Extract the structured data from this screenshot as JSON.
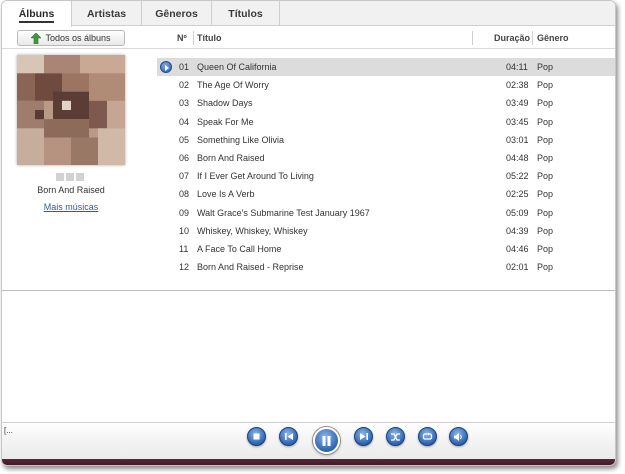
{
  "tabs": [
    {
      "label": "Álbuns",
      "active": true
    },
    {
      "label": "Artistas",
      "active": false
    },
    {
      "label": "Gêneros",
      "active": false
    },
    {
      "label": "Títulos",
      "active": false
    }
  ],
  "toolbar": {
    "all_albums_label": "Todos os álbuns",
    "all_albums_icon": "up-arrow-icon"
  },
  "columns": {
    "number": "Nº",
    "title": "Título",
    "duration": "Duração",
    "genre": "Gênero"
  },
  "album": {
    "name": "Born And Raised",
    "more_link": "Mais músicas"
  },
  "tracks": [
    {
      "num": "01",
      "title": "Queen Of California",
      "duration": "04:11",
      "genre": "Pop",
      "playing": true
    },
    {
      "num": "02",
      "title": "The Age Of Worry",
      "duration": "02:38",
      "genre": "Pop"
    },
    {
      "num": "03",
      "title": "Shadow Days",
      "duration": "03:49",
      "genre": "Pop"
    },
    {
      "num": "04",
      "title": "Speak For Me",
      "duration": "03:45",
      "genre": "Pop"
    },
    {
      "num": "05",
      "title": "Something Like Olivia",
      "duration": "03:01",
      "genre": "Pop"
    },
    {
      "num": "06",
      "title": "Born And Raised",
      "duration": "04:48",
      "genre": "Pop"
    },
    {
      "num": "07",
      "title": "If I Ever Get Around To Living",
      "duration": "05:22",
      "genre": "Pop"
    },
    {
      "num": "08",
      "title": "Love Is A Verb",
      "duration": "02:25",
      "genre": "Pop"
    },
    {
      "num": "09",
      "title": "Walt Grace's Submarine Test January 1967",
      "duration": "05:09",
      "genre": "Pop"
    },
    {
      "num": "10",
      "title": "Whiskey, Whiskey, Whiskey",
      "duration": "04:39",
      "genre": "Pop"
    },
    {
      "num": "11",
      "title": "A Face To Call Home",
      "duration": "04:46",
      "genre": "Pop"
    },
    {
      "num": "12",
      "title": "Born And Raised - Reprise",
      "duration": "02:01",
      "genre": "Pop"
    }
  ],
  "status": {
    "text": "[..."
  },
  "controls": [
    {
      "name": "stop-icon"
    },
    {
      "name": "previous-icon"
    },
    {
      "name": "pause-icon"
    },
    {
      "name": "next-icon"
    },
    {
      "name": "shuffle-icon"
    },
    {
      "name": "repeat-icon"
    },
    {
      "name": "volume-icon"
    }
  ],
  "colors": {
    "accent_blue": "#2c63b0",
    "selected_row": "#dcdcdc",
    "bottom_stripe": "#5b2737",
    "link": "#2f5e96"
  }
}
